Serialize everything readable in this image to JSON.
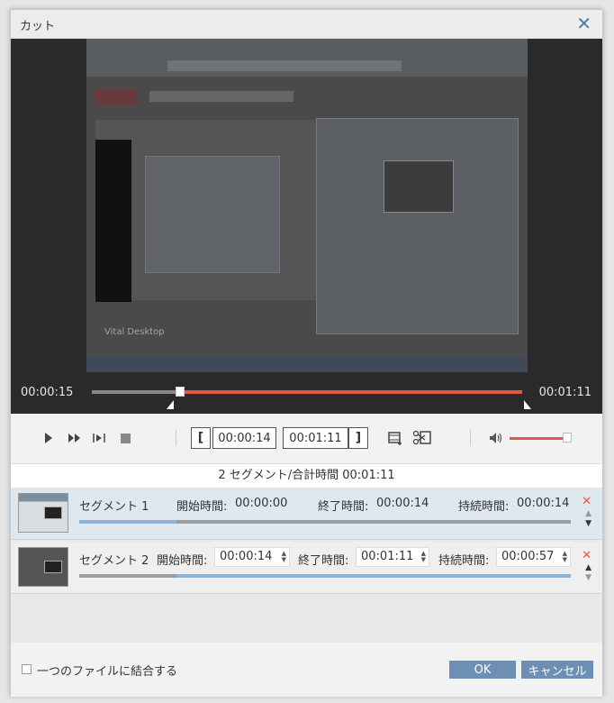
{
  "window": {
    "title": "カット"
  },
  "player": {
    "current_time": "00:00:15",
    "end_time": "00:01:11",
    "progress_fraction": 0.205
  },
  "video_preview": {
    "footer_text": "Vital Desktop"
  },
  "toolbar": {
    "start_time": "00:00:14",
    "end_time": "00:01:11",
    "start_bracket": "[",
    "end_bracket": "]",
    "volume_level": 0.92
  },
  "summary": {
    "text": "2 セグメント/合計時間 00:01:11"
  },
  "segments": [
    {
      "name": "セグメント 1",
      "start_label": "開始時間:",
      "start": "00:00:00",
      "end_label": "終了時間:",
      "end": "00:00:14",
      "duration_label": "持続時間:",
      "duration": "00:00:14",
      "range_fraction": [
        0.0,
        0.197
      ]
    },
    {
      "name": "セグメント 2",
      "start_label": "開始時間:",
      "start": "00:00:14",
      "end_label": "終了時間:",
      "end": "00:01:11",
      "duration_label": "持続時間:",
      "duration": "00:00:57",
      "range_fraction": [
        0.197,
        1.0
      ]
    }
  ],
  "footer": {
    "merge_label": "一つのファイルに結合する",
    "ok_label": "OK",
    "cancel_label": "キャンセル"
  },
  "colors": {
    "accent": "#e05a3f",
    "button": "#6d8fb3",
    "segment_bar": "#8ab4dc"
  },
  "icons": {
    "close": "close-icon",
    "play": "play-icon",
    "fast_forward": "fast-forward-icon",
    "frame_step": "frame-step-icon",
    "stop": "stop-icon",
    "add_segment": "add-segment-icon",
    "split": "split-icon",
    "volume": "volume-icon",
    "delete": "delete-icon",
    "move_up": "move-up-icon",
    "move_down": "move-down-icon"
  }
}
